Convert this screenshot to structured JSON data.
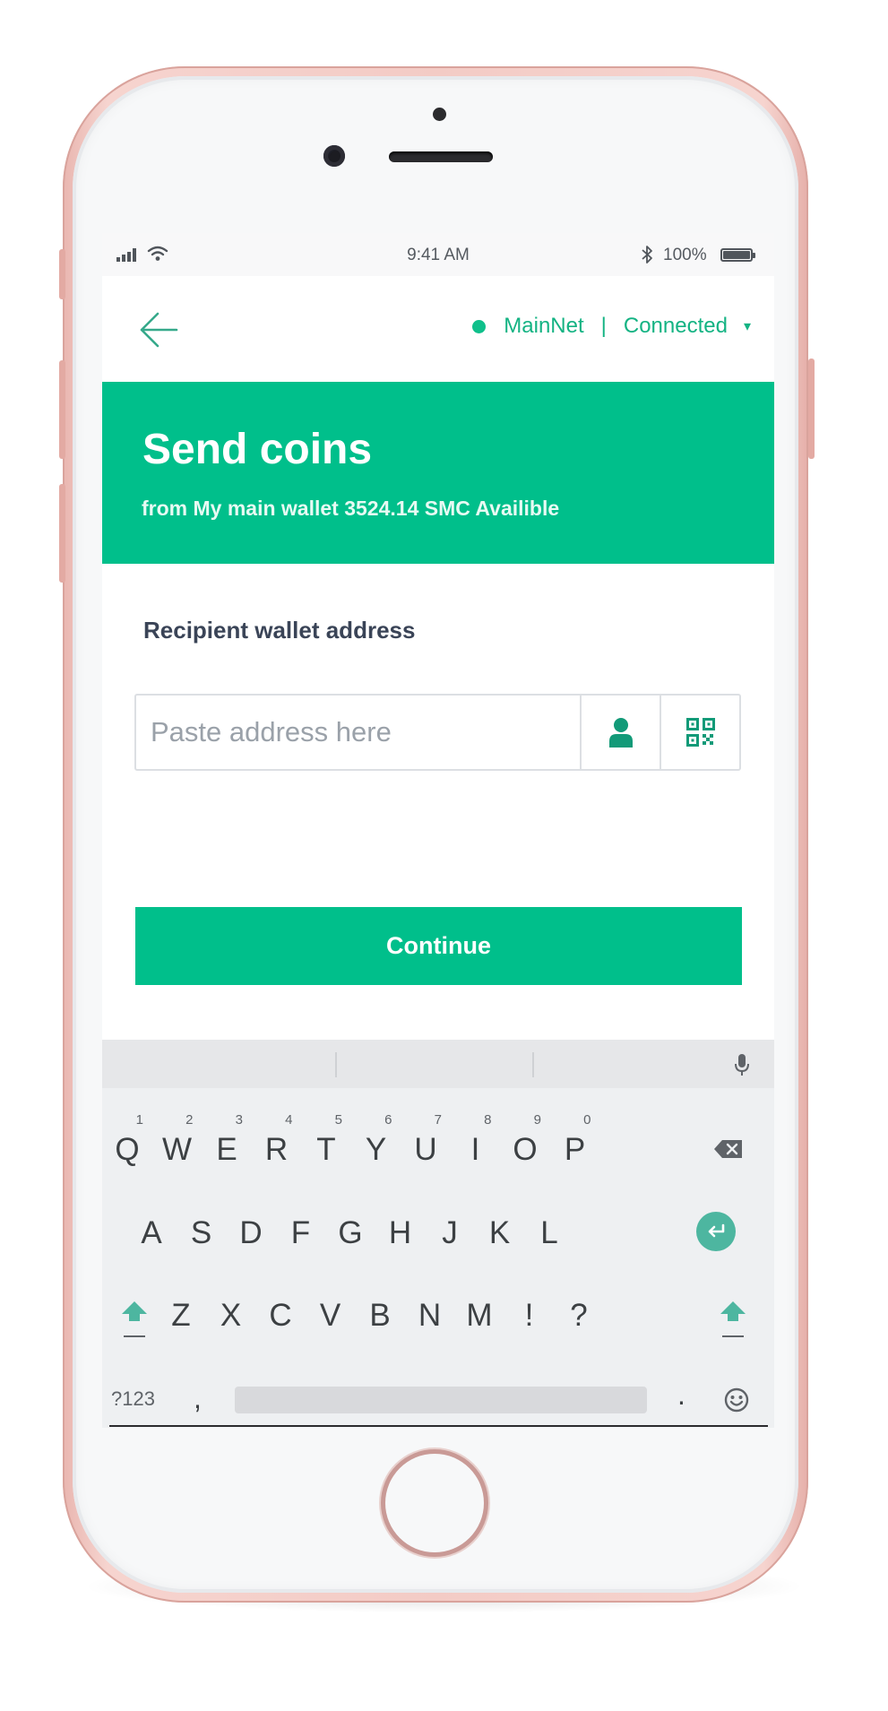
{
  "status_bar": {
    "time": "9:41 AM",
    "battery": "100%",
    "icons": [
      "signal-icon",
      "wifi-icon",
      "bluetooth-icon",
      "battery-icon"
    ]
  },
  "nav": {
    "back_icon": "arrow-left-icon",
    "network_name": "MainNet",
    "separator": "|",
    "network_status": "Connected",
    "caret": "▾"
  },
  "hero": {
    "title": "Send coins",
    "subtitle": "from My main wallet 3524.14 SMC Availible"
  },
  "form": {
    "recipient_label": "Recipient wallet address",
    "address_value": "",
    "address_placeholder": "Paste address here",
    "contact_icon": "person-icon",
    "qr_icon": "qr-code-icon",
    "continue_label": "Continue"
  },
  "keyboard": {
    "row1": [
      {
        "label": "Q",
        "hint": "1"
      },
      {
        "label": "W",
        "hint": "2"
      },
      {
        "label": "E",
        "hint": "3"
      },
      {
        "label": "R",
        "hint": "4"
      },
      {
        "label": "T",
        "hint": "5"
      },
      {
        "label": "Y",
        "hint": "6"
      },
      {
        "label": "U",
        "hint": "7"
      },
      {
        "label": "I",
        "hint": "8"
      },
      {
        "label": "O",
        "hint": "9"
      },
      {
        "label": "P",
        "hint": "0"
      }
    ],
    "row2": [
      "A",
      "S",
      "D",
      "F",
      "G",
      "H",
      "J",
      "K",
      "L"
    ],
    "row3": [
      "Z",
      "X",
      "C",
      "V",
      "B",
      "N",
      "M",
      "!",
      "?"
    ],
    "symbols_label": "?123",
    "comma_label": ",",
    "period_label": ".",
    "accent_color": "#4db6a0"
  },
  "colors": {
    "brand_green": "#00bf8b",
    "network_text": "#14b383",
    "label_text": "#3a4457"
  }
}
